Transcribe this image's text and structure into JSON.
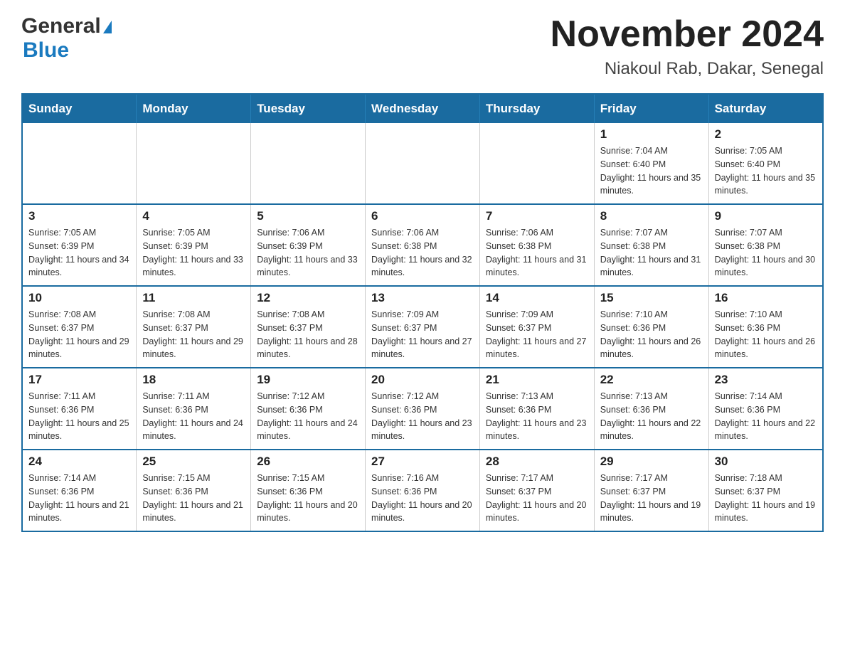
{
  "header": {
    "logo_general": "General",
    "logo_blue": "Blue",
    "title": "November 2024",
    "subtitle": "Niakoul Rab, Dakar, Senegal"
  },
  "weekdays": [
    "Sunday",
    "Monday",
    "Tuesday",
    "Wednesday",
    "Thursday",
    "Friday",
    "Saturday"
  ],
  "weeks": [
    [
      {
        "day": "",
        "info": ""
      },
      {
        "day": "",
        "info": ""
      },
      {
        "day": "",
        "info": ""
      },
      {
        "day": "",
        "info": ""
      },
      {
        "day": "",
        "info": ""
      },
      {
        "day": "1",
        "info": "Sunrise: 7:04 AM\nSunset: 6:40 PM\nDaylight: 11 hours and 35 minutes."
      },
      {
        "day": "2",
        "info": "Sunrise: 7:05 AM\nSunset: 6:40 PM\nDaylight: 11 hours and 35 minutes."
      }
    ],
    [
      {
        "day": "3",
        "info": "Sunrise: 7:05 AM\nSunset: 6:39 PM\nDaylight: 11 hours and 34 minutes."
      },
      {
        "day": "4",
        "info": "Sunrise: 7:05 AM\nSunset: 6:39 PM\nDaylight: 11 hours and 33 minutes."
      },
      {
        "day": "5",
        "info": "Sunrise: 7:06 AM\nSunset: 6:39 PM\nDaylight: 11 hours and 33 minutes."
      },
      {
        "day": "6",
        "info": "Sunrise: 7:06 AM\nSunset: 6:38 PM\nDaylight: 11 hours and 32 minutes."
      },
      {
        "day": "7",
        "info": "Sunrise: 7:06 AM\nSunset: 6:38 PM\nDaylight: 11 hours and 31 minutes."
      },
      {
        "day": "8",
        "info": "Sunrise: 7:07 AM\nSunset: 6:38 PM\nDaylight: 11 hours and 31 minutes."
      },
      {
        "day": "9",
        "info": "Sunrise: 7:07 AM\nSunset: 6:38 PM\nDaylight: 11 hours and 30 minutes."
      }
    ],
    [
      {
        "day": "10",
        "info": "Sunrise: 7:08 AM\nSunset: 6:37 PM\nDaylight: 11 hours and 29 minutes."
      },
      {
        "day": "11",
        "info": "Sunrise: 7:08 AM\nSunset: 6:37 PM\nDaylight: 11 hours and 29 minutes."
      },
      {
        "day": "12",
        "info": "Sunrise: 7:08 AM\nSunset: 6:37 PM\nDaylight: 11 hours and 28 minutes."
      },
      {
        "day": "13",
        "info": "Sunrise: 7:09 AM\nSunset: 6:37 PM\nDaylight: 11 hours and 27 minutes."
      },
      {
        "day": "14",
        "info": "Sunrise: 7:09 AM\nSunset: 6:37 PM\nDaylight: 11 hours and 27 minutes."
      },
      {
        "day": "15",
        "info": "Sunrise: 7:10 AM\nSunset: 6:36 PM\nDaylight: 11 hours and 26 minutes."
      },
      {
        "day": "16",
        "info": "Sunrise: 7:10 AM\nSunset: 6:36 PM\nDaylight: 11 hours and 26 minutes."
      }
    ],
    [
      {
        "day": "17",
        "info": "Sunrise: 7:11 AM\nSunset: 6:36 PM\nDaylight: 11 hours and 25 minutes."
      },
      {
        "day": "18",
        "info": "Sunrise: 7:11 AM\nSunset: 6:36 PM\nDaylight: 11 hours and 24 minutes."
      },
      {
        "day": "19",
        "info": "Sunrise: 7:12 AM\nSunset: 6:36 PM\nDaylight: 11 hours and 24 minutes."
      },
      {
        "day": "20",
        "info": "Sunrise: 7:12 AM\nSunset: 6:36 PM\nDaylight: 11 hours and 23 minutes."
      },
      {
        "day": "21",
        "info": "Sunrise: 7:13 AM\nSunset: 6:36 PM\nDaylight: 11 hours and 23 minutes."
      },
      {
        "day": "22",
        "info": "Sunrise: 7:13 AM\nSunset: 6:36 PM\nDaylight: 11 hours and 22 minutes."
      },
      {
        "day": "23",
        "info": "Sunrise: 7:14 AM\nSunset: 6:36 PM\nDaylight: 11 hours and 22 minutes."
      }
    ],
    [
      {
        "day": "24",
        "info": "Sunrise: 7:14 AM\nSunset: 6:36 PM\nDaylight: 11 hours and 21 minutes."
      },
      {
        "day": "25",
        "info": "Sunrise: 7:15 AM\nSunset: 6:36 PM\nDaylight: 11 hours and 21 minutes."
      },
      {
        "day": "26",
        "info": "Sunrise: 7:15 AM\nSunset: 6:36 PM\nDaylight: 11 hours and 20 minutes."
      },
      {
        "day": "27",
        "info": "Sunrise: 7:16 AM\nSunset: 6:36 PM\nDaylight: 11 hours and 20 minutes."
      },
      {
        "day": "28",
        "info": "Sunrise: 7:17 AM\nSunset: 6:37 PM\nDaylight: 11 hours and 20 minutes."
      },
      {
        "day": "29",
        "info": "Sunrise: 7:17 AM\nSunset: 6:37 PM\nDaylight: 11 hours and 19 minutes."
      },
      {
        "day": "30",
        "info": "Sunrise: 7:18 AM\nSunset: 6:37 PM\nDaylight: 11 hours and 19 minutes."
      }
    ]
  ]
}
